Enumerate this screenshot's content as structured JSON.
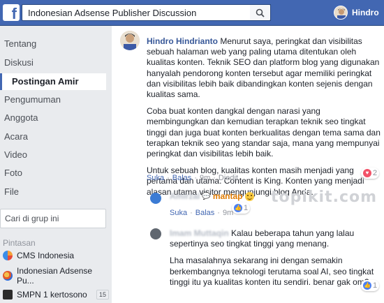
{
  "topbar": {
    "search_value": "Indonesian Adsense Publisher Discussion",
    "user_name": "Hindro",
    "brand_color": "#4267b2"
  },
  "sidebar": {
    "items": [
      {
        "label": "Tentang"
      },
      {
        "label": "Diskusi"
      },
      {
        "label": "Postingan Amir"
      },
      {
        "label": "Pengumuman"
      },
      {
        "label": "Anggota"
      },
      {
        "label": "Acara"
      },
      {
        "label": "Video"
      },
      {
        "label": "Foto"
      },
      {
        "label": "File"
      }
    ],
    "active_item": "Postingan Amir",
    "group_search_placeholder": "Cari di grup ini",
    "shortcuts_title": "Pintasan",
    "shortcuts": [
      {
        "label": "CMS Indonesia",
        "icon": "pie-icon",
        "badge": ""
      },
      {
        "label": "Indonesian Adsense Pu...",
        "icon": "globe-icon",
        "badge": ""
      },
      {
        "label": "SMPN 1 kertosono",
        "icon": "school-icon",
        "badge": "15"
      }
    ]
  },
  "comment": {
    "author": "Hindro Hindrianto",
    "paragraph1": "Menurut saya, peringkat dan visibilitas sebuah halaman web yang paling utama ditentukan oleh kualitas konten. Teknik SEO dan platform blog yang digunakan hanyalah pendorong konten tersebut agar memiliki peringkat dan visibilitas lebih baik dibandingkan konten sejenis dengan kualitas sama.",
    "paragraph2": "Coba buat konten dangkal dengan narasi yang membingungkan dan kemudian terapkan teknik seo tingkat tinggi dan juga buat konten berkualitas dengan tema sama dan terapkan teknik seo yang standar saja, mana yang mempunyai peringkat dan visibilitas lebih baik.",
    "paragraph3": "Untuk sebuah blog, kualitas konten masih menjadi yang pertama dan utama. Content is King. Konten yang menjadi alasan utama visitor mengunjungi blog Anda.",
    "actions": {
      "like": "Suka",
      "reply": "Balas",
      "time": "9m",
      "edited": "Diedit"
    },
    "reaction_count": "2"
  },
  "reply1": {
    "author": "Amirzal",
    "text": "mantap",
    "actions": {
      "like": "Suka",
      "reply": "Balas",
      "time": "9m"
    },
    "reaction_count": "1"
  },
  "reply2": {
    "author": "Imam Muttaqin",
    "paragraph1": "Kalau beberapa tahun yang lalau sepertinya seo tingkat tinggi yang menang.",
    "paragraph2": "Lha masalahnya sekarang ini dengan semakin berkembangnya teknologi terutama soal AI, seo tingkat tinggi itu ya kualitas konten itu sendiri. benar gak om?",
    "reaction_count": "1"
  },
  "watermark": "topikit.com"
}
